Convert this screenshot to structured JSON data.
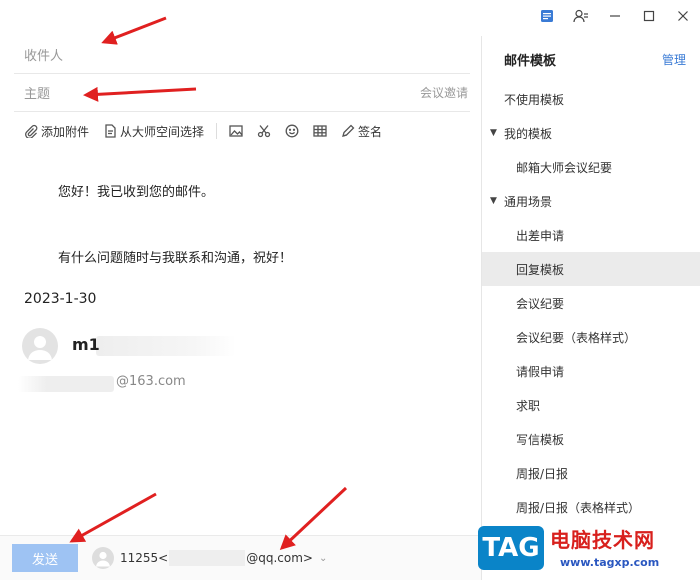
{
  "compose": {
    "to_placeholder": "收件人",
    "subject_placeholder": "主题",
    "meeting_invite": "会议邀请",
    "toolbar": {
      "attach": "添加附件",
      "from_space": "从大师空间选择",
      "signature": "签名",
      "icons": [
        "image-icon",
        "scissors-icon",
        "emoji-icon",
        "table-icon",
        "pen-icon"
      ]
    },
    "body": {
      "greeting": "您好！我已收到您的邮件。",
      "closing": "有什么问题随时与我联系和沟通，祝好！"
    },
    "signature": {
      "date": "2023-1-30",
      "name": "m1",
      "email_suffix": "@163.com"
    },
    "bottom": {
      "send": "发送",
      "sender_prefix": "11255<",
      "sender_suffix": "@qq.com>"
    }
  },
  "panel": {
    "title": "邮件模板",
    "manage": "管理",
    "items": [
      {
        "label": "不使用模板",
        "kind": "root"
      },
      {
        "label": "我的模板",
        "kind": "group"
      },
      {
        "label": "邮箱大师会议纪要",
        "kind": "child"
      },
      {
        "label": "通用场景",
        "kind": "group"
      },
      {
        "label": "出差申请",
        "kind": "child"
      },
      {
        "label": "回复模板",
        "kind": "child",
        "selected": true
      },
      {
        "label": "会议纪要",
        "kind": "child"
      },
      {
        "label": "会议纪要（表格样式）",
        "kind": "child"
      },
      {
        "label": "请假申请",
        "kind": "child"
      },
      {
        "label": "求职",
        "kind": "child"
      },
      {
        "label": "写信模板",
        "kind": "child"
      },
      {
        "label": "周报/日报",
        "kind": "child"
      },
      {
        "label": "周报/日报（表格样式）",
        "kind": "child"
      }
    ]
  },
  "watermark": {
    "tag": "TAG",
    "site_name": "电脑技术网",
    "url": "www.tagxp.com"
  },
  "colors": {
    "accent": "#3a7bd5",
    "send_button": "#9ec3f3",
    "arrow": "#e02020",
    "selected_row": "#ebebeb"
  }
}
